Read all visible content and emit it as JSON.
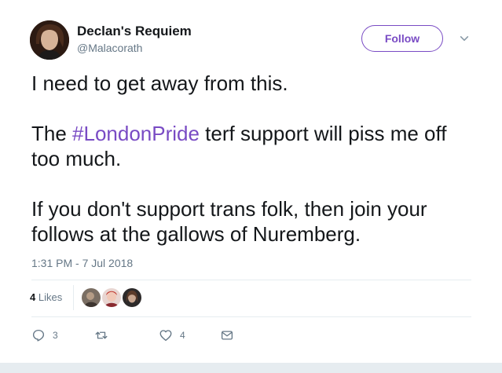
{
  "user": {
    "display_name": "Declan's Requiem",
    "handle": "@Malacorath"
  },
  "follow_button": {
    "label": "Follow"
  },
  "tweet": {
    "line1": "I need to get away from this.",
    "para2_prefix": "The ",
    "hashtag": "#LondonPride",
    "para2_suffix": " terf support will piss me off too much.",
    "para3": "If you don't support trans folk, then join your follows at the gallows of Nuremberg."
  },
  "timestamp": "1:31 PM - 7 Jul 2018",
  "likes": {
    "count": "4",
    "label": "Likes"
  },
  "likers": [
    {
      "avatar": "liker-avatar-1"
    },
    {
      "avatar": "liker-avatar-2"
    },
    {
      "avatar": "liker-avatar-3"
    }
  ],
  "actions": {
    "reply": {
      "icon": "reply-icon",
      "count": "3"
    },
    "retweet": {
      "icon": "retweet-icon",
      "count": ""
    },
    "like": {
      "icon": "heart-icon",
      "count": "4"
    },
    "message": {
      "icon": "envelope-icon"
    }
  },
  "colors": {
    "accent": "#794bc4",
    "text": "#14171a",
    "muted": "#657786",
    "divider": "#e6ecf0"
  }
}
